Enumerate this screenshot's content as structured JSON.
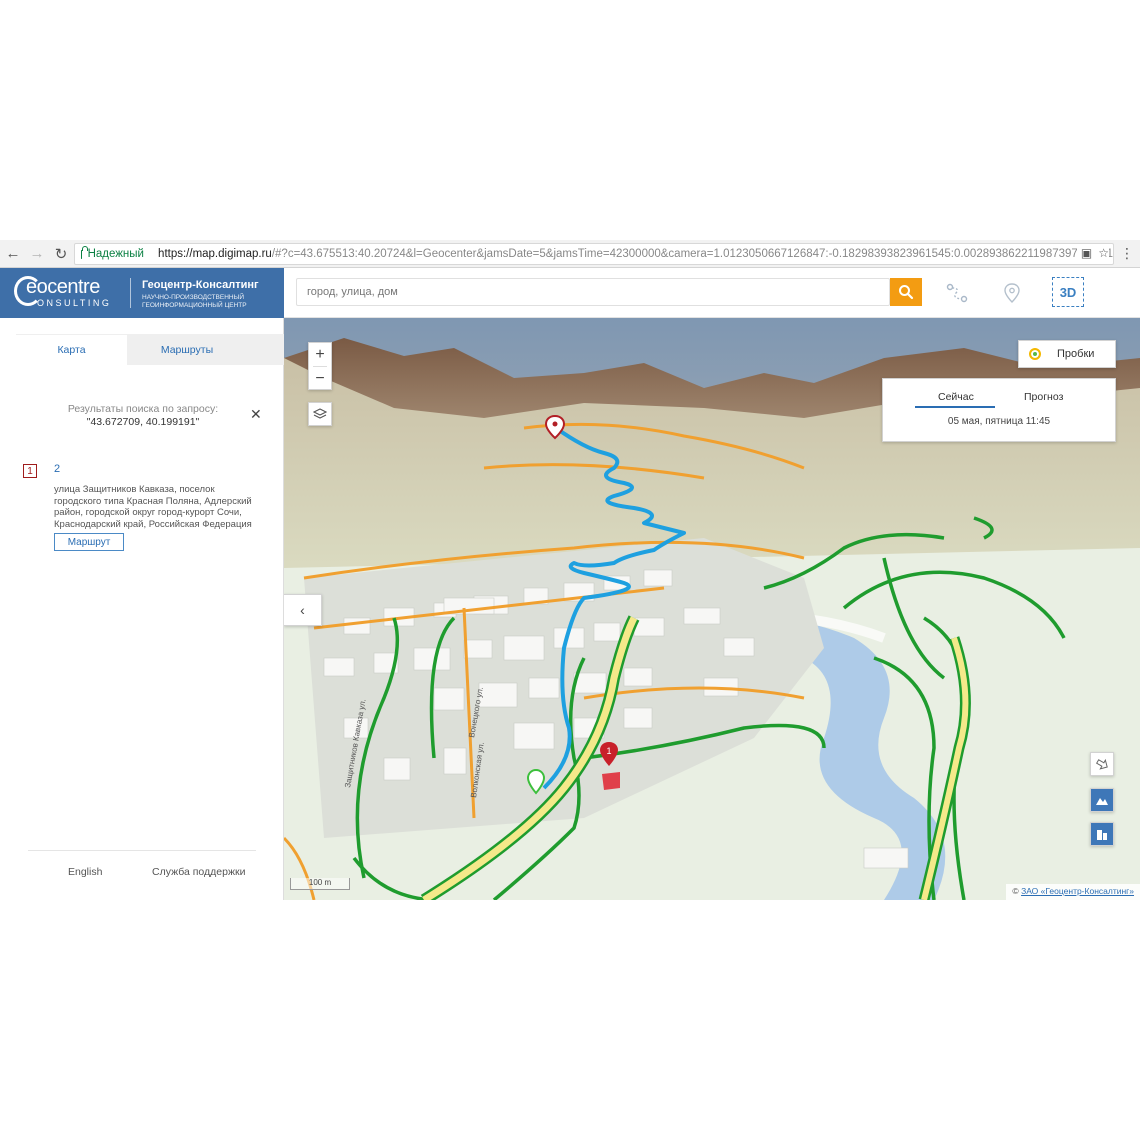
{
  "browser": {
    "secure_label": "Надежный",
    "url_host": "https://map.digimap.ru",
    "url_rest": "/#?c=43.675513:40.20724&l=Geocenter&jamsDate=5&jamsTime=42300000&camera=1.0123050667126847:-0.18298393823961545:0.0028938622119873​97:35301"
  },
  "brand": {
    "logo_word": "eocentre",
    "logo_sub": "ONSULTING",
    "title": "Геоцентр-Консалтинг",
    "subtitle": "НАУЧНО-ПРОИЗВОДСТВЕННЫЙ ГЕОИНФОРМАЦИОННЫЙ ЦЕНТР"
  },
  "search": {
    "placeholder": "город, улица, дом"
  },
  "toolbar": {
    "mode_3d": "3D"
  },
  "sidebar": {
    "tabs": [
      {
        "label": "Карта"
      },
      {
        "label": "Маршруты"
      }
    ],
    "results_heading": "Результаты поиска по запросу:",
    "results_query": "\"43.672709, 40.199191\"",
    "result": {
      "index": "1",
      "title": "2",
      "address": "улица Защитников Кавказа, поселок городского типа Красная Поляна, Адлерский район, городской округ город-курорт Сочи, Краснодарский край, Российская Федерация",
      "route_button": "Маршрут"
    },
    "footer": {
      "language": "English",
      "support": "Служба поддержки"
    }
  },
  "map": {
    "traffic_label": "Пробки",
    "time_tabs": [
      "Сейчас",
      "Прогноз"
    ],
    "time_active": "Сейчас",
    "time_date": "05 мая, пятница 11:45",
    "scale_label": "100 m",
    "copyright_prefix": "©",
    "copyright_link": "ЗАО «Геоцентр-Консалтинг»",
    "street_labels": [
      "Вонецкого ул.",
      "Защитников Кавказа ул.",
      "Волконская ул."
    ],
    "marker_number": "1"
  },
  "colors": {
    "brand_blue": "#3e6fa8",
    "search_orange": "#f39c12",
    "route_blue": "#1ea0e0",
    "traffic_green": "#1f9c2e",
    "road_orange": "#f0a030",
    "marker_red": "#c8202a"
  }
}
